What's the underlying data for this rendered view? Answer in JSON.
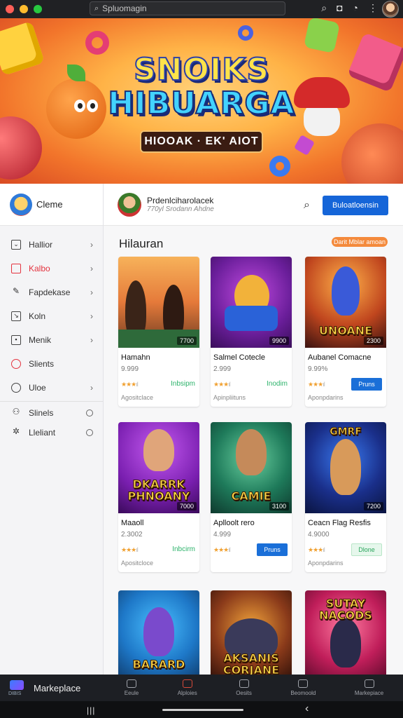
{
  "browser": {
    "search_placeholder": "Spluomagin"
  },
  "banner": {
    "title_line1": "SNOIKS",
    "title_line2": "HIBUARGA",
    "subtitle": "HIOOAK · EK' AIOT"
  },
  "sidebar": {
    "brand": "Cleme",
    "items": [
      {
        "label": "Hallior",
        "icon": "inbox-icon",
        "active": false
      },
      {
        "label": "Kalbo",
        "icon": "folder-icon",
        "active": true
      },
      {
        "label": "Fapdekase",
        "icon": "pencil-icon",
        "active": false
      },
      {
        "label": "Koln",
        "icon": "chart-icon",
        "active": false
      },
      {
        "label": "Menik",
        "icon": "document-icon",
        "active": false
      },
      {
        "label": "Slients",
        "icon": "circle-dot-icon",
        "active": false
      },
      {
        "label": "Uloe",
        "icon": "search-icon",
        "active": false
      }
    ],
    "sub_items": [
      {
        "label": "Slinels",
        "icon": "people-icon"
      },
      {
        "label": "Lleliant",
        "icon": "gear-icon"
      }
    ]
  },
  "header": {
    "user_name": "Prdenlciharolacek",
    "user_sub": "770yl Srodann Ahdne",
    "button_label": "Buloatloensin"
  },
  "section": {
    "title": "Hilauran",
    "pill": "Darit Mblar amoan"
  },
  "cards": [
    {
      "name": "Hamahn",
      "num": "9.999",
      "price": "7700",
      "rating": 3,
      "tag": "Inbsipm",
      "dev": "Agositclace"
    },
    {
      "name": "Salmel Cotecle",
      "num": "2.999",
      "price": "9900",
      "rating": 3,
      "tag": "Inodim",
      "dev": "Apinpliituns"
    },
    {
      "name": "Aubanel Comacne",
      "num": "9.99%",
      "price": "2300",
      "rating": 3,
      "button": "Pruns",
      "dev": "Aponpdarins",
      "thumb_text": "UNOANE"
    },
    {
      "name": "Maaoll",
      "num": "2.3002",
      "price": "7000",
      "rating": 3,
      "tag": "Inbcirm",
      "dev": "Apositcloce",
      "thumb_text": "DKARRK PHNOANY"
    },
    {
      "name": "Aplloolt rero",
      "num": "4.999",
      "price": "3100",
      "rating": 3,
      "button": "Pruns",
      "dev": "",
      "thumb_text": "CAMIE"
    },
    {
      "name": "Ceacn Flag Resfis",
      "num": "4.9000",
      "price": "7200",
      "rating": 3,
      "button": "Dlone",
      "dev": "Aponpdarins",
      "thumb_text": "GMRF"
    },
    {
      "name": "",
      "num": "",
      "price": "",
      "rating": 0,
      "dev": "",
      "thumb_text": "BARARD"
    },
    {
      "name": "",
      "num": "",
      "price": "",
      "rating": 0,
      "dev": "",
      "thumb_text": "AKSANIS CORJANE"
    },
    {
      "name": "",
      "num": "",
      "price": "",
      "rating": 0,
      "dev": "",
      "thumb_text": "SUTAY NACODS"
    }
  ],
  "bottom": {
    "home_label": "Markeplace",
    "home_sub": "DIBIS",
    "tabs": [
      "Eeule",
      "Alploies",
      "Oesits",
      "Beomoold",
      "Markepiace"
    ]
  },
  "colors": {
    "accent": "#1565d8",
    "active_nav": "#e4333f",
    "tag_green": "#2db36b",
    "pill": "#f48a3c"
  }
}
